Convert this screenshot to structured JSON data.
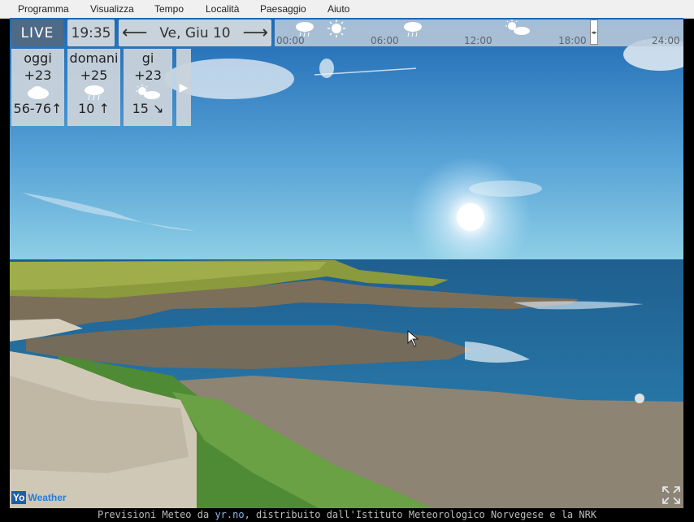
{
  "menu": [
    "Programma",
    "Visualizza",
    "Tempo",
    "Località",
    "Paesaggio",
    "Aiuto"
  ],
  "toolbar": {
    "live": "LIVE",
    "time": "19:35",
    "date": "Ve, Giu 10",
    "prev_arrow": "⟵",
    "next_arrow": "⟶"
  },
  "timeline": {
    "hours": [
      "00:00",
      "06:00",
      "12:00",
      "18:00",
      "24:00"
    ],
    "slider_glyph": "◂▸",
    "icons": [
      "cloud-rain-icon",
      "sun-icon",
      "cloud-rain-icon",
      "sun-cloud-icon"
    ]
  },
  "forecast": [
    {
      "day": "oggi",
      "temp": "+23",
      "icon": "cloud-icon",
      "wind": "56-76",
      "wind_arrow": "↑"
    },
    {
      "day": "domani",
      "temp": "+25",
      "icon": "cloud-rain-icon",
      "wind": "10",
      "wind_arrow": "↑"
    },
    {
      "day": "gi",
      "temp": "+23",
      "icon": "sun-cloud-icon",
      "wind": "15",
      "wind_arrow": "↘"
    }
  ],
  "forecast_next": "▶",
  "brand": {
    "a": "Yo",
    "b": "Weather"
  },
  "footer": {
    "pre": "Previsioni Meteo da ",
    "link": "yr.no",
    "post": ", distribuito dall'Istituto Meteorologico Norvegese e la NRK"
  },
  "colors": {
    "live_bg": "#4f6a85",
    "panel_bg": "#c9d3db",
    "sky_top": "#1f6fb6",
    "sea": "#2a78ad"
  }
}
